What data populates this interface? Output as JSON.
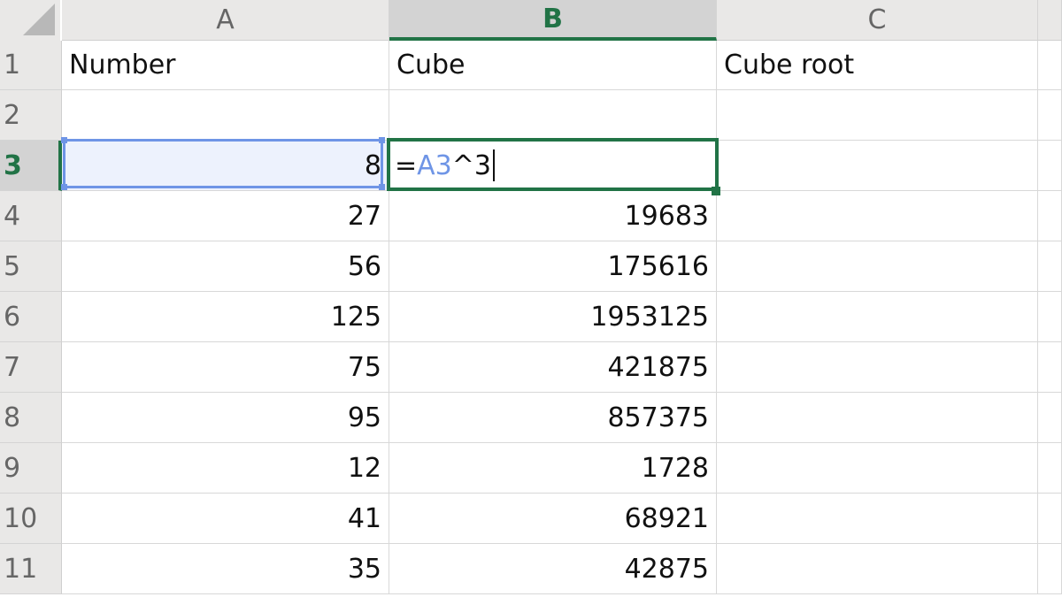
{
  "columns": [
    "A",
    "B",
    "C"
  ],
  "rows": [
    "1",
    "2",
    "3",
    "4",
    "5",
    "6",
    "7",
    "8",
    "9",
    "10",
    "11"
  ],
  "header_row": {
    "a": "Number",
    "b": "Cube",
    "c": "Cube root"
  },
  "data": [
    {
      "a": "",
      "b": ""
    },
    {
      "a": "8",
      "b": ""
    },
    {
      "a": "27",
      "b": "19683"
    },
    {
      "a": "56",
      "b": "175616"
    },
    {
      "a": "125",
      "b": "1953125"
    },
    {
      "a": "75",
      "b": "421875"
    },
    {
      "a": "95",
      "b": "857375"
    },
    {
      "a": "12",
      "b": "1728"
    },
    {
      "a": "41",
      "b": "68921"
    },
    {
      "a": "35",
      "b": "42875"
    }
  ],
  "edit": {
    "prefix": "=",
    "ref": "A3",
    "suffix": "^3"
  },
  "colors": {
    "active": "#217346",
    "ref": "#6f95e6"
  }
}
